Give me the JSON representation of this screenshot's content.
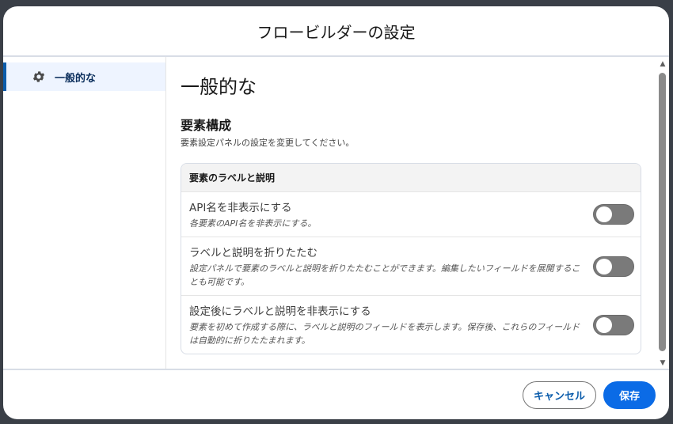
{
  "modal": {
    "title": "フロービルダーの設定"
  },
  "sidebar": {
    "items": [
      {
        "label": "一般的な",
        "icon": "gear-icon",
        "active": true
      }
    ]
  },
  "main": {
    "heading": "一般的な",
    "section": {
      "title": "要素構成",
      "description": "要素設定パネルの設定を変更してください。"
    },
    "card": {
      "header": "要素のラベルと説明",
      "rows": [
        {
          "title": "API名を非表示にする",
          "description": "各要素のAPI名を非表示にする。",
          "toggle_on": false
        },
        {
          "title": "ラベルと説明を折りたたむ",
          "description": "設定パネルで要素のラベルと説明を折りたたむことができます。編集したいフィールドを展開することも可能です。",
          "toggle_on": false
        },
        {
          "title": "設定後にラベルと説明を非表示にする",
          "description": "要素を初めて作成する際に、ラベルと説明のフィールドを表示します。保存後、これらのフィールドは自動的に折りたたまれます。",
          "toggle_on": false
        }
      ]
    }
  },
  "footer": {
    "cancel_label": "キャンセル",
    "save_label": "保存"
  },
  "colors": {
    "brand": "#0b6be6",
    "toggle_off": "#7a7a7a",
    "nav_active_bg": "#eef4ff"
  }
}
